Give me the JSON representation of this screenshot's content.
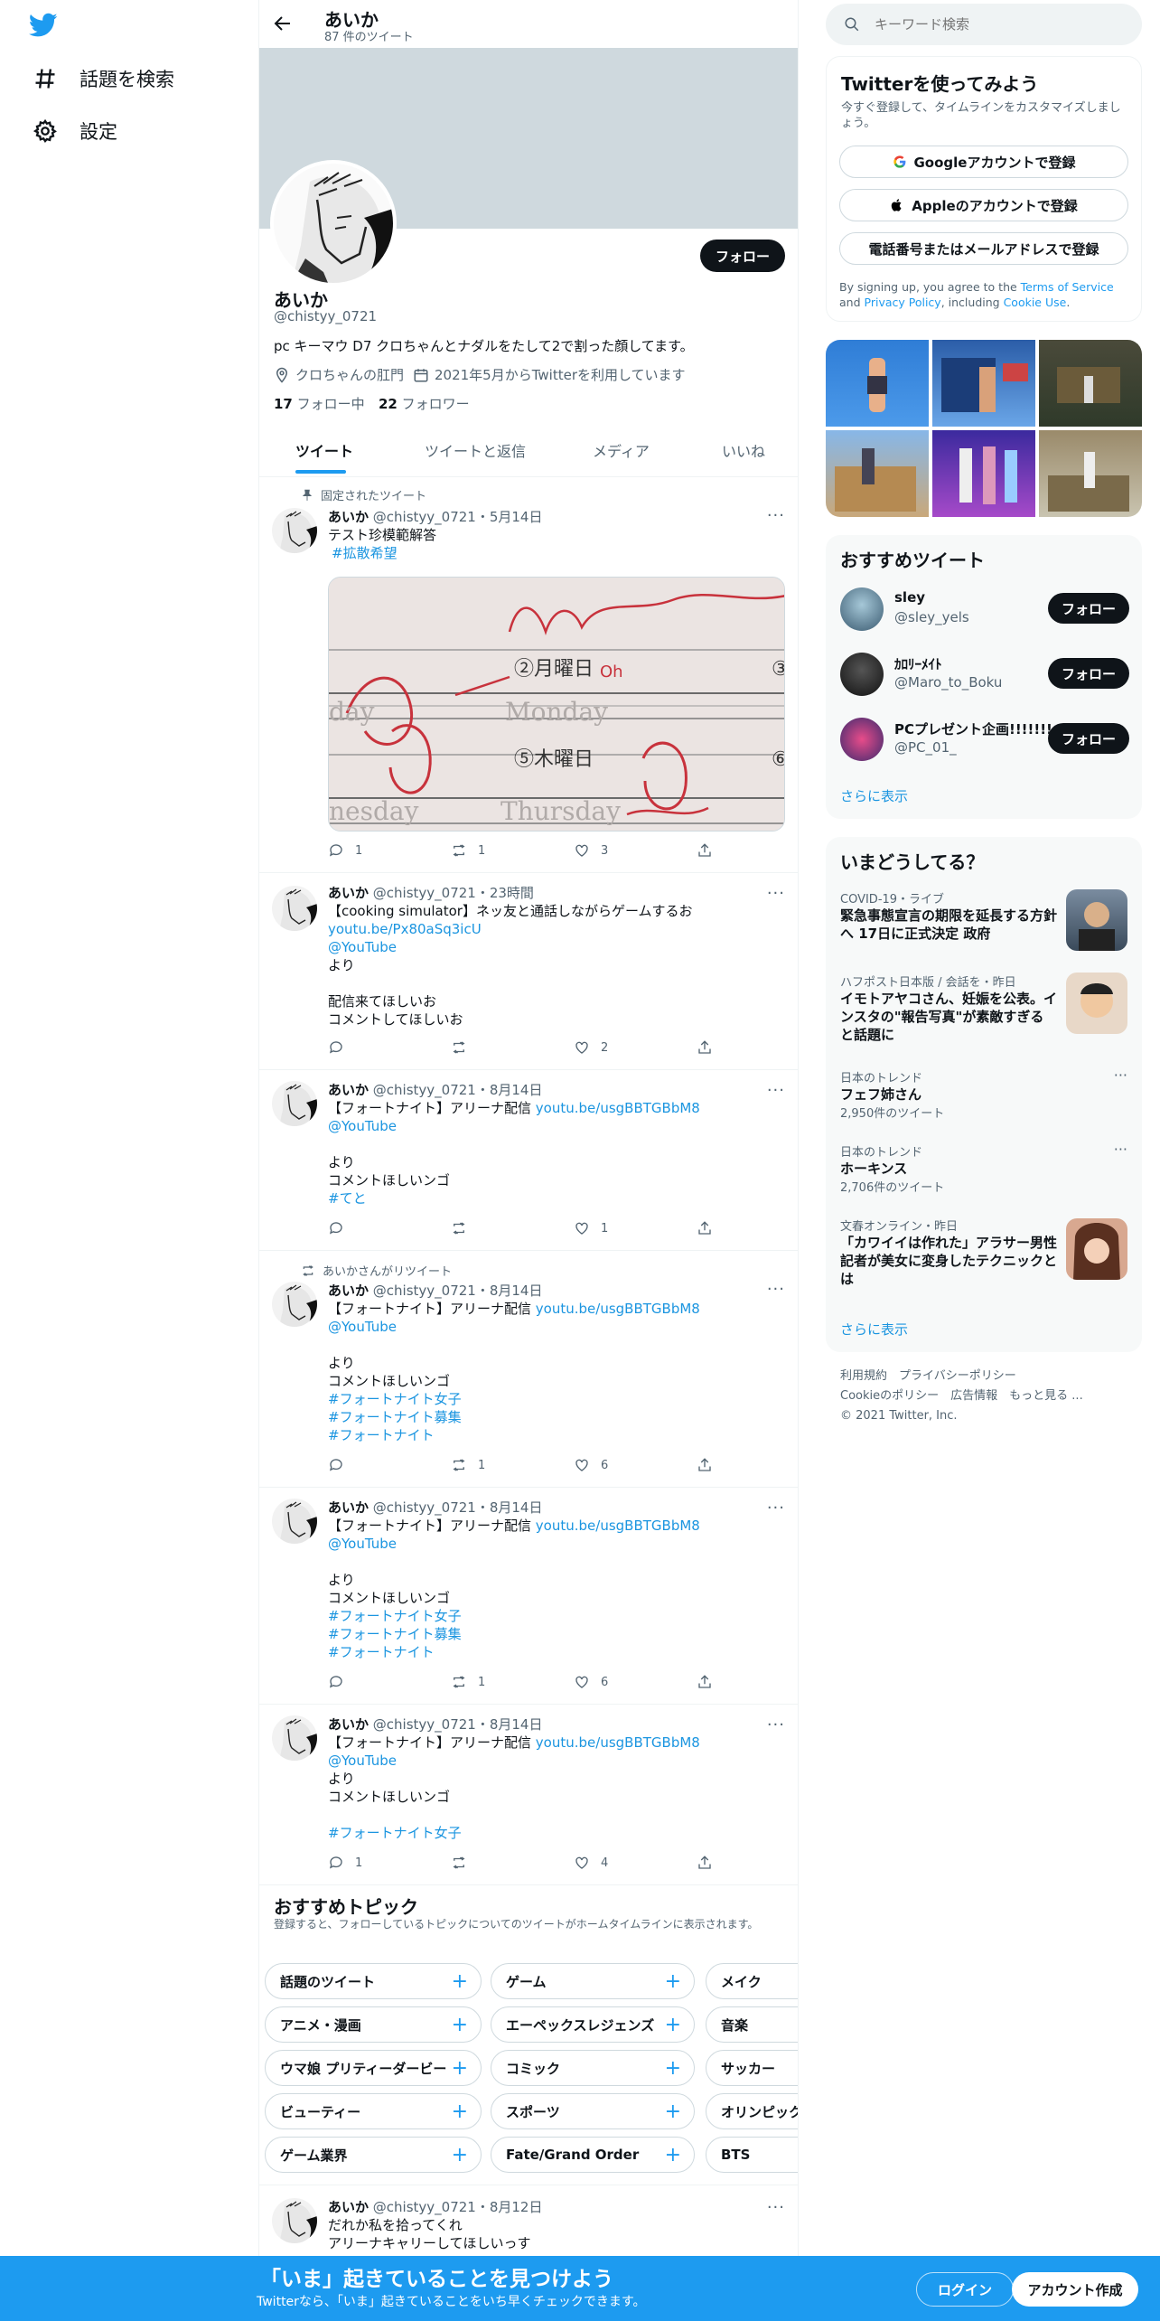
{
  "nav": {
    "explore": "話題を検索",
    "settings": "設定"
  },
  "header": {
    "name": "あいか",
    "count": "87 件のツイート"
  },
  "profile": {
    "name": "あいか",
    "handle": "@chistyy_0721",
    "bio": "pc キーマウ D7 クロちゃんとナダルをたして2で割った顔してます。",
    "location": "クロちゃんの肛門",
    "joined": "2021年5月からTwitterを利用しています",
    "following_count": "17",
    "following_label": "フォロー中",
    "followers_count": "22",
    "followers_label": "フォロワー",
    "follow_button": "フォロー"
  },
  "tabs": [
    "ツイート",
    "ツイートと返信",
    "メディア",
    "いいね"
  ],
  "pinned_label": "固定されたツイート",
  "retweet_label": "あいかさんがリツイート",
  "tweets": [
    {
      "name": "あいか",
      "meta": "@chistyy_0721・5月14日",
      "l1": "テスト珍模範解答",
      "l2": "#拡散希望",
      "reply": "1",
      "rt": "1",
      "like": "3",
      "img": {
        "a": "②月曜日",
        "b": "Monday",
        "c": "⑤木曜日",
        "d": "Thursday",
        "e": "nesday",
        "f": "day",
        "g": "③",
        "h": "⑥",
        "i": "Oh"
      }
    },
    {
      "name": "あいか",
      "meta": "@chistyy_0721・23時間",
      "l1": "【cooking simulator】ネッ友と通話しながらゲームするお",
      "l2": "youtu.be/Px80aSq3icU",
      "l3": "@YouTube",
      "l4": "より",
      "l5": "配信来てほしいお",
      "l6": "コメントしてほしいお",
      "reply": "",
      "rt": "",
      "like": "2"
    },
    {
      "name": "あいか",
      "meta": "@chistyy_0721・8月14日",
      "l1": "【フォートナイト】アリーナ配信",
      "link": "youtu.be/usgBBTGBbM8",
      "l2": "@YouTube",
      "l3": "より",
      "l4": "コメントほしいンゴ",
      "l5": "#てと",
      "reply": "",
      "rt": "",
      "like": "1"
    },
    {
      "name": "あいか",
      "meta": "@chistyy_0721・8月14日",
      "l1": "【フォートナイト】アリーナ配信",
      "link": "youtu.be/usgBBTGBbM8",
      "l2": "@YouTube",
      "l3": "より",
      "l4": "コメントほしいンゴ",
      "l5": "#フォートナイト女子",
      "l6": "#フォートナイト募集",
      "l7": "#フォートナイト",
      "reply": "",
      "rt": "1",
      "like": "6"
    },
    {
      "name": "あいか",
      "meta": "@chistyy_0721・8月14日",
      "l1": "【フォートナイト】アリーナ配信",
      "link": "youtu.be/usgBBTGBbM8",
      "l2": "@YouTube",
      "l3": "より",
      "l4": "コメントほしいンゴ",
      "l5": "#フォートナイト女子",
      "l6": "#フォートナイト募集",
      "l7": "#フォートナイト",
      "reply": "",
      "rt": "1",
      "like": "6"
    },
    {
      "name": "あいか",
      "meta": "@chistyy_0721・8月14日",
      "l1": "【フォートナイト】アリーナ配信",
      "link": "youtu.be/usgBBTGBbM8",
      "l2": "@YouTube",
      "l3": "より",
      "l4": "コメントほしいンゴ",
      "l5": "#フォートナイト女子",
      "reply": "1",
      "rt": "",
      "like": "4"
    },
    {
      "name": "あいか",
      "meta": "@chistyy_0721・8月12日",
      "l1": "だれか私を拾ってくれ",
      "l2": "アリーナキャリーしてほしいっす"
    }
  ],
  "topics": {
    "title": "おすすめトピック",
    "desc": "登録すると、フォローしているトピックについてのツイートがホームタイムラインに表示されます。",
    "chips": [
      [
        "話題のツイート",
        "ゲーム",
        "メイク"
      ],
      [
        "アニメ・漫画",
        "エーペックスレジェンズ",
        "音楽"
      ],
      [
        "ウマ娘 プリティーダービー",
        "コミック",
        "サッカー"
      ],
      [
        "ビューティー",
        "スポーツ",
        "オリンピック"
      ],
      [
        "ゲーム業界",
        "Fate/Grand Order",
        "BTS"
      ]
    ]
  },
  "search": {
    "placeholder": "キーワード検索"
  },
  "signup": {
    "title": "Twitterを使ってみよう",
    "desc": "今すぐ登録して、タイムラインをカスタマイズしましょう。",
    "google": "Googleアカウントで登録",
    "apple": "Appleのアカウントで登録",
    "phone": "電話番号またはメールアドレスで登録",
    "terms_1": "By signing up, you agree to the",
    "terms_tos": "Terms of Service",
    "terms_and": "and",
    "terms_privacy": "Privacy Policy",
    "terms_incl": ", including",
    "terms_cookie": "Cookie Use",
    "terms_dot": "."
  },
  "recommended": {
    "title": "おすすめツイート",
    "users": [
      {
        "name": "sley",
        "handle": "@sley_yels",
        "color": "#6a8aa0"
      },
      {
        "name": "ｶﾛﾘｰﾒｲﾄ",
        "handle": "@Maro_to_Boku",
        "color": "#2a2a2a"
      },
      {
        "name": "PCプレゼント企画!!!!!!!",
        "handle": "@PC_01_",
        "color": "#3b2a6e"
      }
    ],
    "follow": "フォロー",
    "more": "さらに表示"
  },
  "trends": {
    "title": "いまどうしてる？",
    "items": [
      {
        "ctx": "COVID-19・ライブ",
        "title": "緊急事態宣言の期限を延長する方針へ 17日に正式決定 政府",
        "count": ""
      },
      {
        "ctx": "ハフポスト日本版 / 会話を・昨日",
        "title": "イモトアヤコさん、妊娠を公表。インスタの\"報告写真\"が素敵すぎると話題に",
        "count": ""
      },
      {
        "ctx": "日本のトレンド",
        "title": "フェフ姉さん",
        "count": "2,950件のツイート"
      },
      {
        "ctx": "日本のトレンド",
        "title": "ホーキンス",
        "count": "2,706件のツイート"
      },
      {
        "ctx": "文春オンライン・昨日",
        "title": "「カワイイは作れた」アラサー男性記者が美女に変身したテクニックとは",
        "count": ""
      }
    ],
    "more": "さらに表示"
  },
  "footer": {
    "l1a": "利用規約",
    "l1b": "プライバシーポリシー",
    "l2a": "Cookieのポリシー",
    "l2b": "広告情報",
    "l2c": "もっと見る ...",
    "copy": "© 2021 Twitter, Inc."
  },
  "bottom": {
    "title": "「いま」起きていることを見つけよう",
    "sub": "Twitterなら、「いま」起きていることをいち早くチェックできます。",
    "login": "ログイン",
    "signup": "アカウント作成"
  },
  "colors": {
    "accent": "#1d9bf0",
    "bottom_bar": "#1d9bf0"
  }
}
